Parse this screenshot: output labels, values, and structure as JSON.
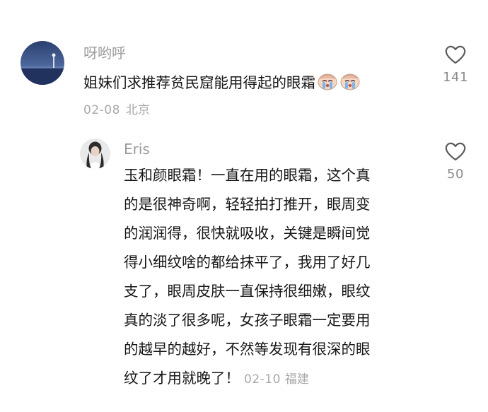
{
  "comment": {
    "username": "呀哟呼",
    "text": "姐妹们求推荐贫民窟能用得起的眼霜",
    "emoji": [
      "crying-face-emoji",
      "crying-face-emoji"
    ],
    "date": "02-08",
    "location": "北京",
    "like_count": "141",
    "like_icon": "heart-outline-icon"
  },
  "reply": {
    "username": "Eris",
    "lines": [
      "玉和颜眼霜！一直在用的眼霜，这个真",
      "的是很神奇啊，轻轻拍打推开，眼周变",
      "的润润得，很快就吸收，关键是瞬间觉",
      "得小细纹啥的都给抹平了，我用了好几",
      "支了，眼周皮肤一直保持很细嫩，眼纹",
      "真的淡了很多呢，女孩子眼霜一定要用",
      "的越早的越好，不然等发现有很深的眼",
      "纹了才用就晚了！"
    ],
    "date": "02-10",
    "location": "福建",
    "like_count": "50",
    "like_icon": "heart-outline-icon"
  },
  "colors": {
    "text_primary": "#161616",
    "text_secondary": "#9a9a9a",
    "icon": "#5a5a5a",
    "background": "#ffffff"
  }
}
